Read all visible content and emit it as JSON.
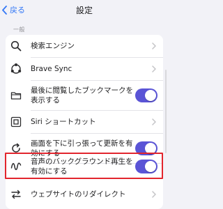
{
  "nav": {
    "back_label": "戻る",
    "title": "設定"
  },
  "section": {
    "header": "一般"
  },
  "rows": [
    {
      "label": "検索エンジン",
      "control": "chevron",
      "icon": "search-icon"
    },
    {
      "label": "Brave Sync",
      "control": "chevron",
      "icon": "sync-icon"
    },
    {
      "label": "最後に閲覧したブックマークを表示する",
      "control": "toggle",
      "on": true,
      "icon": "folder-icon"
    },
    {
      "label": "Siri ショートカット",
      "control": "chevron",
      "icon": "siri-icon"
    },
    {
      "label": "画面を下に引っ張って更新を有効にする",
      "control": "toggle",
      "on": true,
      "icon": "refresh-icon"
    },
    {
      "label": "音声のバックグラウンド再生を有効にする",
      "control": "toggle",
      "on": true,
      "icon": "audio-wave-icon"
    },
    {
      "label": "ウェブサイトのリダイレクト",
      "control": "chevron",
      "icon": "redirect-icon"
    }
  ],
  "colors": {
    "accent": "#3478f6",
    "toggle_on": "#5a54d6",
    "highlight": "#e2252d",
    "background": "#f2f2f7"
  }
}
